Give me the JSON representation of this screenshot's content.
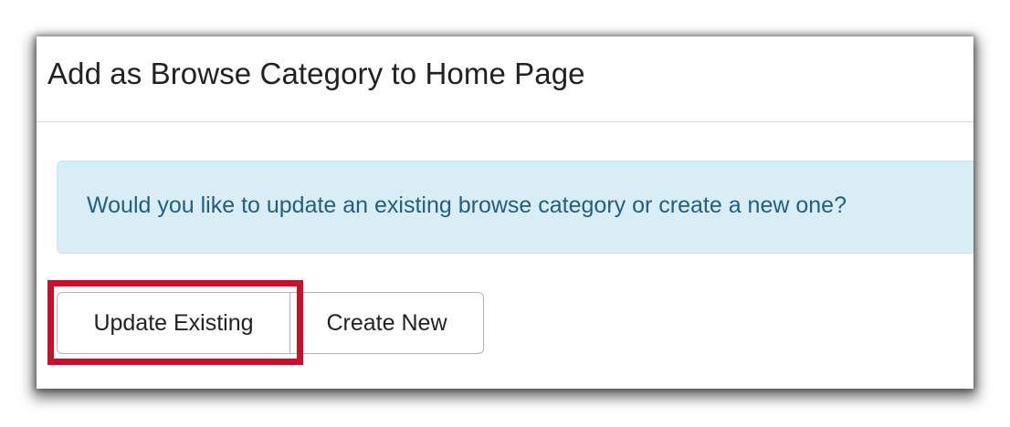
{
  "modal": {
    "title": "Add as Browse Category to Home Page"
  },
  "alert": {
    "message": "Would you like to update an existing browse category or create a new one?"
  },
  "buttons": {
    "update_existing": "Update Existing",
    "create_new": "Create New"
  },
  "colors": {
    "alert_background": "#d9edf7",
    "alert_border": "#bce8f1",
    "alert_text": "#245d80",
    "highlight": "#c8102e"
  }
}
